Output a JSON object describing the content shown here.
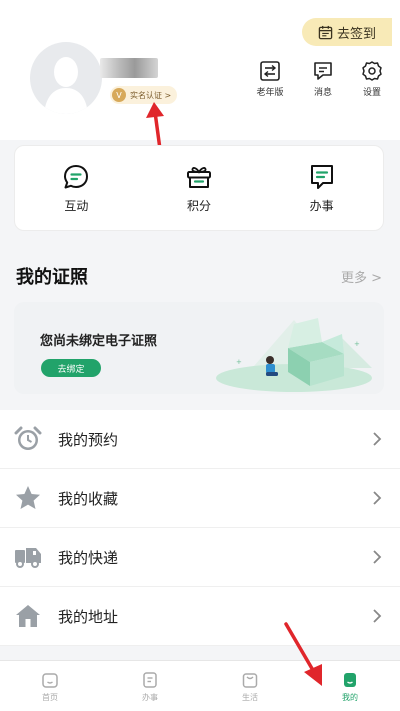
{
  "header": {
    "checkin_label": "去签到",
    "verify_badge": "V",
    "verify_label": "实名认证 >",
    "icons": [
      {
        "name": "elder-mode",
        "label": "老年版"
      },
      {
        "name": "messages",
        "label": "消息"
      },
      {
        "name": "settings",
        "label": "设置"
      }
    ]
  },
  "quick_actions": [
    {
      "name": "interaction",
      "label": "互动"
    },
    {
      "name": "points",
      "label": "积分"
    },
    {
      "name": "affairs",
      "label": "办事"
    }
  ],
  "certificates": {
    "title": "我的证照",
    "more_label": "更多 >",
    "empty_text": "您尚未绑定电子证照",
    "bind_label": "去绑定"
  },
  "menu": [
    {
      "name": "appointments",
      "label": "我的预约"
    },
    {
      "name": "favorites",
      "label": "我的收藏"
    },
    {
      "name": "deliveries",
      "label": "我的快递"
    },
    {
      "name": "addresses",
      "label": "我的地址"
    }
  ],
  "tabbar": [
    {
      "name": "home",
      "label": "首页"
    },
    {
      "name": "affairs",
      "label": "办事"
    },
    {
      "name": "life",
      "label": "生活"
    },
    {
      "name": "mine",
      "label": "我的"
    }
  ],
  "colors": {
    "accent": "#22a36a",
    "checkin_bg": "#f8eab7",
    "annotation_arrow": "#e0262b"
  }
}
